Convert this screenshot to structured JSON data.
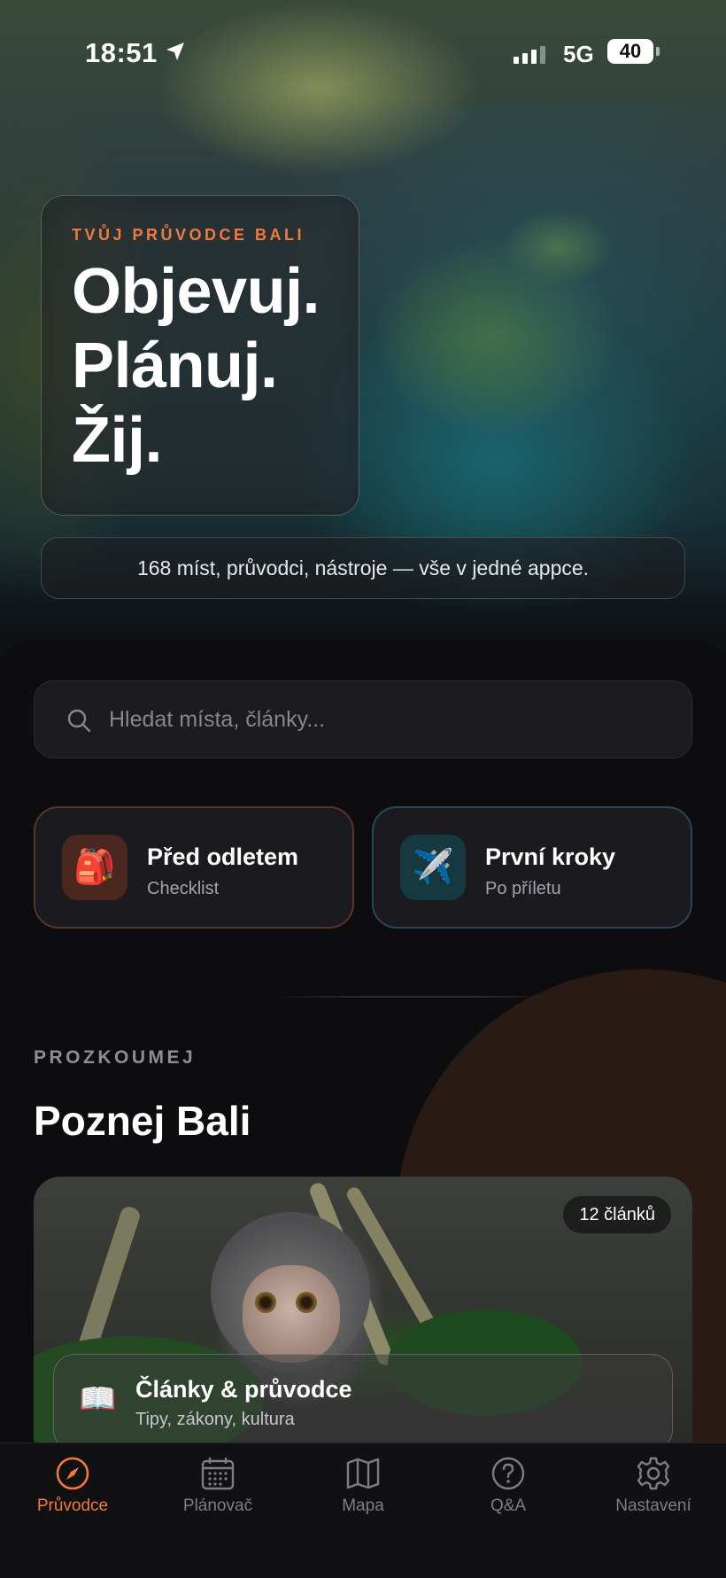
{
  "status_bar": {
    "time": "18:51",
    "network": "5G",
    "battery": "40",
    "location_icon": "location-arrow-icon",
    "signal_icon": "signal-bars-icon"
  },
  "hero": {
    "kicker": "TVŮJ PRŮVODCE BALI",
    "title_lines": [
      "Objevuj.",
      "Plánuj.",
      "Žij."
    ],
    "tagline": "168 míst, průvodci, nástroje — vše v jedné appce."
  },
  "search": {
    "placeholder": "Hledat místa, články...",
    "value": "",
    "icon": "search-icon"
  },
  "quick_actions": [
    {
      "title": "Před odletem",
      "subtitle": "Checklist",
      "icon": "backpack-icon",
      "glyph": "🎒"
    },
    {
      "title": "První kroky",
      "subtitle": "Po příletu",
      "icon": "airplane-icon",
      "glyph": "✈️"
    }
  ],
  "section": {
    "kicker": "PROZKOUMEJ",
    "title": "Poznej Bali"
  },
  "feature_card": {
    "badge": "12 článků",
    "title": "Články & průvodce",
    "subtitle": "Tipy, zákony, kultura",
    "icon": "book-icon",
    "glyph": "📖"
  },
  "tabbar": {
    "items": [
      {
        "label": "Průvodce",
        "icon": "compass-icon",
        "active": true
      },
      {
        "label": "Plánovač",
        "icon": "calendar-icon",
        "active": false
      },
      {
        "label": "Mapa",
        "icon": "map-icon",
        "active": false
      },
      {
        "label": "Q&A",
        "icon": "question-icon",
        "active": false
      },
      {
        "label": "Nastavení",
        "icon": "gear-icon",
        "active": false
      }
    ]
  },
  "colors": {
    "accent": "#f07a3e",
    "background": "#0d0d10",
    "card": "#1b1b1f",
    "muted_text": "#86868c"
  }
}
